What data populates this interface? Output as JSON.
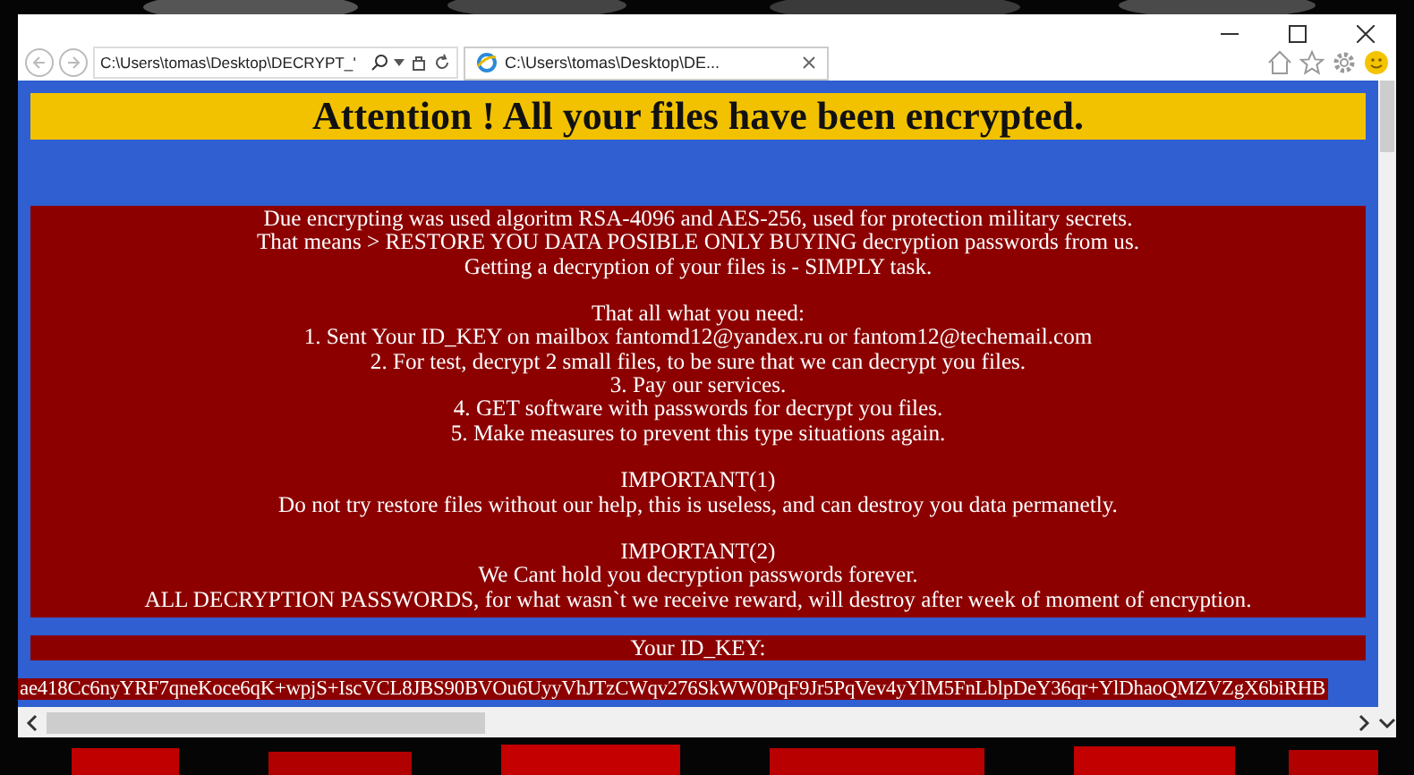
{
  "window": {
    "address_bar": {
      "value": "C:\\Users\\tomas\\Desktop\\DECRYPT_'"
    },
    "tabs": [
      {
        "label": "C:\\Users\\tomas\\Desktop\\DE...",
        "selected": true
      }
    ]
  },
  "note": {
    "heading": "Attention ! All your files have been encrypted.",
    "blocks": [
      [
        "Due encrypting was used algoritm RSA-4096 and AES-256, used for protection military secrets.",
        "That means > RESTORE YOU DATA POSIBLE ONLY BUYING decryption passwords from us.",
        "Getting a decryption of your files is - SIMPLY task."
      ],
      [
        "That all what you need:",
        "1. Sent Your ID_KEY on mailbox fantomd12@yandex.ru or fantom12@techemail.com",
        "2. For test, decrypt 2 small files, to be sure that we can decrypt you files.",
        "3. Pay our services.",
        "4. GET software with passwords for decrypt you files.",
        "5. Make measures to prevent this type situations again."
      ],
      [
        "IMPORTANT(1)",
        "Do not try restore files without our help, this is useless, and can destroy you data permanetly."
      ],
      [
        "IMPORTANT(2)",
        "We Cant hold you decryption passwords forever.",
        "ALL DECRYPTION PASSWORDS, for what wasn`t we receive reward, will destroy after week of moment of encryption."
      ]
    ],
    "id_key_label": "Your ID_KEY:",
    "id_key": "ae418Cc6nyYRF7qneKoce6qK+wpjS+IscVCL8JBS90BVOu6UyyVhJTzCWqv276SkWW0PqF9Jr5PqVev4yYlM5FnLblpDeY36qr+YlDhaoQMZVZgX6biRHB"
  }
}
